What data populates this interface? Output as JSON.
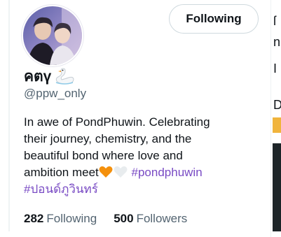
{
  "profile": {
    "display_name": "คตү",
    "handle": "@ppw_only",
    "follow_button_label": "Following",
    "bio": {
      "line1": "In awe of PondPhuwin. Celebrating",
      "line2": "their journey, chemistry, and the",
      "line3": "beautiful bond where love and",
      "line4_prefix": "ambition meet",
      "hashtag1": "#pondphuwin",
      "hashtag2": "#ปอนด์ภูวินทร์"
    },
    "stats": {
      "following_count": "282",
      "following_label": "Following",
      "followers_count": "500",
      "followers_label": "Followers"
    },
    "icons": {
      "name_emoji": "swan-icon",
      "heart1": "orange-heart-icon",
      "heart2": "white-heart-icon"
    }
  },
  "side_panel": {
    "chars": [
      "ſ",
      "n",
      "I",
      "D"
    ]
  },
  "colors": {
    "text_primary": "#0f1419",
    "text_secondary": "#536471",
    "hashtag": "#794bc4",
    "border": "#cfd9de",
    "orange_heart": "#f4900c"
  }
}
